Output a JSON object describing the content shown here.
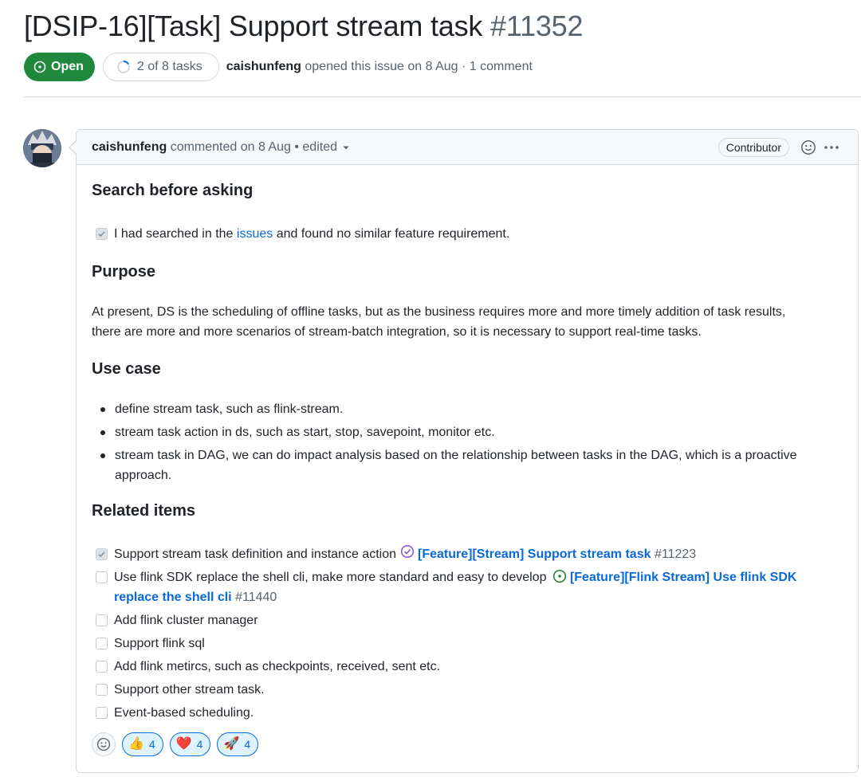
{
  "issue": {
    "title": "[DSIP-16][Task] Support stream task",
    "number": "#11352",
    "state": "Open",
    "tasks": "2 of 8 tasks",
    "author": "caishunfeng",
    "opened_text": "opened this issue on 8 Aug · 1 comment"
  },
  "comment": {
    "author": "caishunfeng",
    "meta": "commented on 8 Aug •",
    "edited": "edited",
    "role": "Contributor",
    "icons": {
      "reaction": "smiley-icon",
      "more": "kebab-horizontal-icon",
      "edited_caret": "triangle-down-icon"
    },
    "sections": {
      "search": {
        "heading": "Search before asking",
        "check_pre": "I had searched in the",
        "check_link": "issues",
        "check_post": "and found no similar feature requirement."
      },
      "purpose": {
        "heading": "Purpose",
        "line1": "At present, DS is the scheduling of offline tasks, but as the business requires more and more timely addition of task results,",
        "line2": "there are more and more scenarios of stream-batch integration, so it is necessary to support real-time tasks."
      },
      "use_case": {
        "heading": "Use case",
        "items": [
          "define stream task, such as flink-stream.",
          "stream task action in ds, such as start, stop, savepoint, monitor etc.",
          "stream task in DAG, we can do impact analysis based on the relationship between tasks in the DAG, which is a proactive",
          "approach."
        ]
      },
      "related": {
        "heading": "Related items",
        "item1_text": "Support stream task definition and instance action",
        "item1_link": "[Feature][Stream] Support stream task",
        "item1_num": "#11223",
        "item2_text": "Use flink SDK replace the shell cli, make more standard and easy to develop",
        "item2_link_a": "[Feature][Flink Stream] Use flink SDK",
        "item2_link_b": "replace the shell cli",
        "item2_num": "#11440",
        "items": [
          "Add flink cluster manager",
          "Support flink sql",
          "Add flink metircs, such as checkpoints, received, sent etc.",
          "Support other stream task.",
          "Event-based scheduling."
        ]
      }
    },
    "reactions": [
      {
        "emoji": "👍",
        "count": "4",
        "icon": "thumbs-up-icon"
      },
      {
        "emoji": "❤️",
        "count": "4",
        "icon": "heart-icon"
      },
      {
        "emoji": "🚀",
        "count": "4",
        "icon": "rocket-icon"
      }
    ]
  },
  "colors": {
    "open_green": "#1f883d",
    "link_blue": "#0969da",
    "muted": "#59636e",
    "border": "#d1d9e0"
  }
}
